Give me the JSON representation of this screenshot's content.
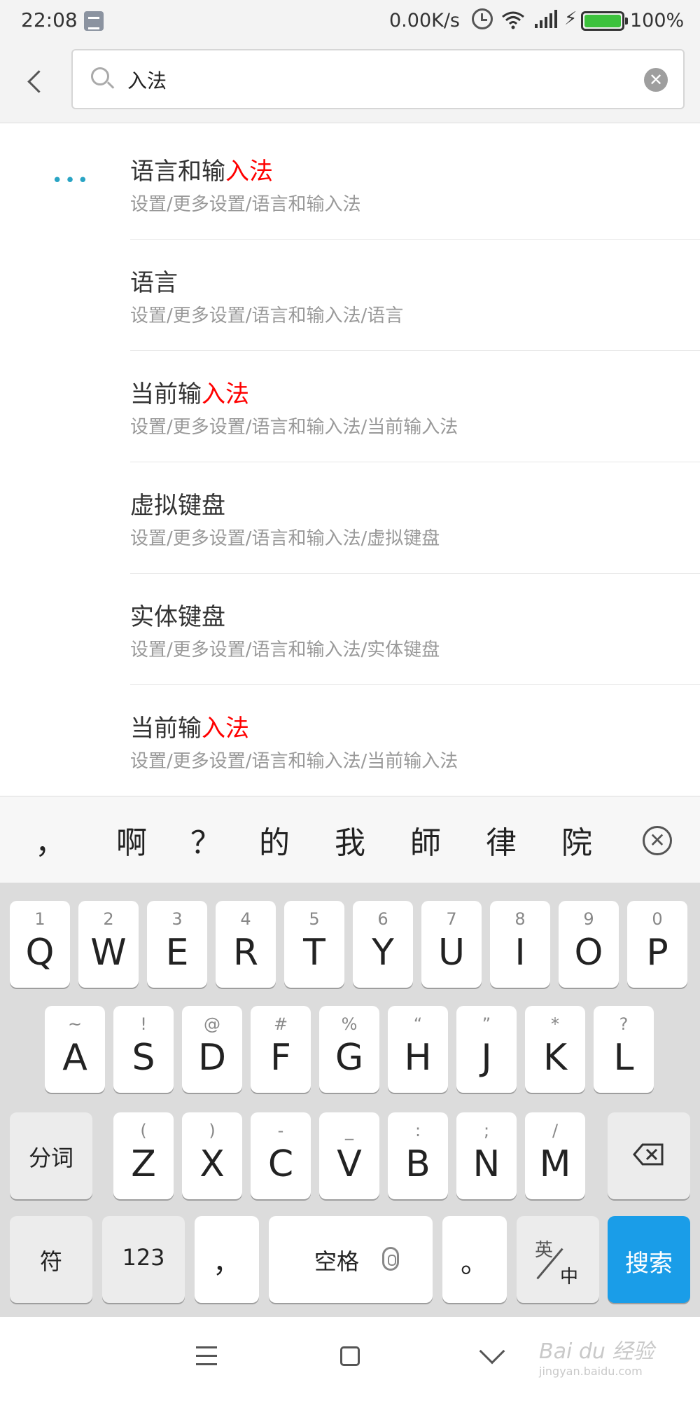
{
  "status_bar": {
    "time": "22:08",
    "net_speed": "0.00K/s",
    "battery_percent": "100%",
    "battery_level": 1.0
  },
  "search": {
    "query": "入法"
  },
  "results": [
    {
      "title_prefix": "语言和输",
      "title_highlight": "入法",
      "path": "设置/更多设置/语言和输入法"
    },
    {
      "title_prefix": "语言",
      "title_highlight": "",
      "path": "设置/更多设置/语言和输入法/语言"
    },
    {
      "title_prefix": "当前输",
      "title_highlight": "入法",
      "path": "设置/更多设置/语言和输入法/当前输入法"
    },
    {
      "title_prefix": "虚拟键盘",
      "title_highlight": "",
      "path": "设置/更多设置/语言和输入法/虚拟键盘"
    },
    {
      "title_prefix": "实体键盘",
      "title_highlight": "",
      "path": "设置/更多设置/语言和输入法/实体键盘"
    },
    {
      "title_prefix": "当前输",
      "title_highlight": "入法",
      "path": "设置/更多设置/语言和输入法/当前输入法"
    }
  ],
  "keyboard": {
    "candidates": [
      "，",
      "啊",
      "？",
      "的",
      "我",
      "師",
      "律",
      "院"
    ],
    "row1": [
      {
        "main": "Q",
        "sub": "1"
      },
      {
        "main": "W",
        "sub": "2"
      },
      {
        "main": "E",
        "sub": "3"
      },
      {
        "main": "R",
        "sub": "4"
      },
      {
        "main": "T",
        "sub": "5"
      },
      {
        "main": "Y",
        "sub": "6"
      },
      {
        "main": "U",
        "sub": "7"
      },
      {
        "main": "I",
        "sub": "8"
      },
      {
        "main": "O",
        "sub": "9"
      },
      {
        "main": "P",
        "sub": "0"
      }
    ],
    "row2": [
      {
        "main": "A",
        "sub": "~"
      },
      {
        "main": "S",
        "sub": "!"
      },
      {
        "main": "D",
        "sub": "@"
      },
      {
        "main": "F",
        "sub": "#"
      },
      {
        "main": "G",
        "sub": "%"
      },
      {
        "main": "H",
        "sub": "“"
      },
      {
        "main": "J",
        "sub": "”"
      },
      {
        "main": "K",
        "sub": "*"
      },
      {
        "main": "L",
        "sub": "?"
      }
    ],
    "row3": [
      {
        "main": "Z",
        "sub": "("
      },
      {
        "main": "X",
        "sub": ")"
      },
      {
        "main": "C",
        "sub": "-"
      },
      {
        "main": "V",
        "sub": "_"
      },
      {
        "main": "B",
        "sub": ":"
      },
      {
        "main": "N",
        "sub": ";"
      },
      {
        "main": "M",
        "sub": "/"
      }
    ],
    "segment_label": "分词",
    "symbol_label": "符",
    "numbers_label": "123",
    "comma_label": "，",
    "space_label": "空格",
    "period_label": "。",
    "lang_top": "英",
    "lang_bottom": "中",
    "search_label": "搜索"
  },
  "watermark": {
    "text": "Bai du 经验",
    "sub": "jingyan.baidu.com"
  },
  "colors": {
    "highlight": "#ff0000",
    "accent": "#1a9de8",
    "more_dots": "#29a4c4"
  },
  "icons": [
    "back-arrow-icon",
    "search-icon",
    "clear-icon",
    "more-icon",
    "close-candidates-icon",
    "backspace-icon",
    "mic-icon",
    "menu-icon",
    "home-icon",
    "back-icon"
  ]
}
